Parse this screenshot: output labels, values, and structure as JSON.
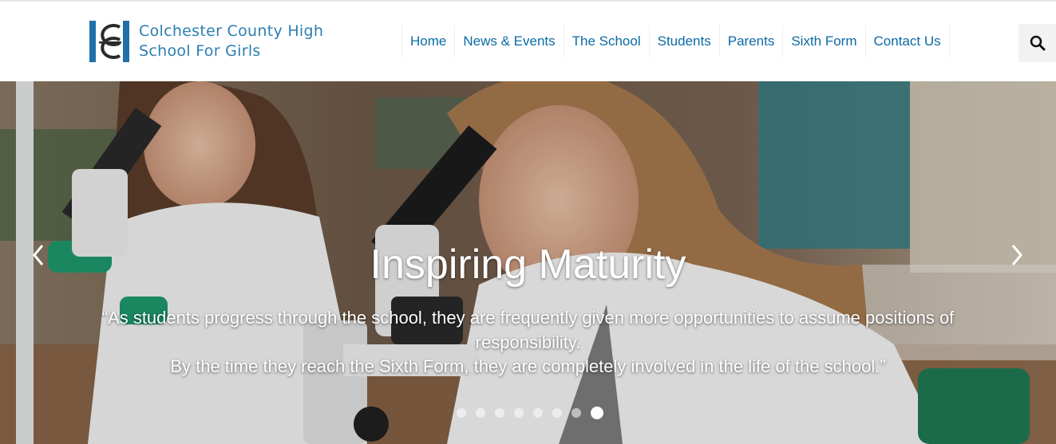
{
  "school": {
    "name_line1": "Colchester County High",
    "name_line2": "School For Girls",
    "logo_icon": "cchs-monogram-logo"
  },
  "nav": {
    "items": [
      {
        "label": "Home"
      },
      {
        "label": "News & Events"
      },
      {
        "label": "The School"
      },
      {
        "label": "Students"
      },
      {
        "label": "Parents"
      },
      {
        "label": "Sixth Form"
      },
      {
        "label": "Contact Us"
      }
    ],
    "search_icon": "search-icon"
  },
  "hero": {
    "title": "Inspiring Maturity",
    "quote_line1": "“As students progress through the school, they are frequently given more opportunities to assume positions of",
    "quote_line2": "responsibility.",
    "quote_line3": "By the time they reach the Sixth Form, they are completely involved in the life of the school.”",
    "slide_count": 8,
    "active_slide": 8,
    "prev_icon": "chevron-left-icon",
    "next_icon": "chevron-right-icon"
  },
  "colors": {
    "brand_blue": "#2b7fb0",
    "nav_blue": "#0b6aa4"
  }
}
